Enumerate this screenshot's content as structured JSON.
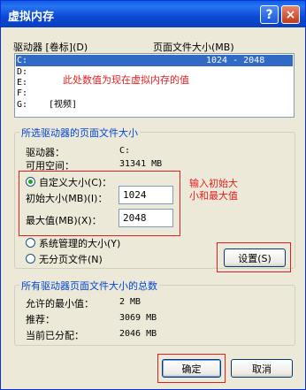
{
  "window": {
    "title": "虚拟内存",
    "help_label": "?",
    "close_label": "×"
  },
  "drives": {
    "header_drive": "驱动器 [卷标](D)",
    "header_size": "页面文件大小(MB)",
    "items": [
      {
        "drive": "C:",
        "size": "1024 - 2048",
        "selected": true
      },
      {
        "drive": "D:",
        "size": ""
      },
      {
        "drive": "E:",
        "size": ""
      },
      {
        "drive": "F:",
        "size": ""
      },
      {
        "drive": "G:",
        "label": "[视频]",
        "size": ""
      }
    ]
  },
  "selected_drive": {
    "group_title": "所选驱动器的页面文件大小",
    "drive_label": "驱动器：",
    "drive_value": "C:",
    "space_label": "可用空间：",
    "space_value": "31341 MB",
    "custom_size_label": "自定义大小(C)：",
    "initial_label": "初始大小(MB)(I)：",
    "initial_value": "1024",
    "max_label": "最大值(MB)(X)：",
    "max_value": "2048",
    "system_managed_label": "系统管理的大小(Y)",
    "no_paging_label": "无分页文件(N)",
    "set_button": "设置(S)"
  },
  "totals": {
    "group_title": "所有驱动器页面文件大小的总数",
    "min_label": "允许的最小值：",
    "min_value": "2 MB",
    "recommended_label": "推荐：",
    "recommended_value": "3069 MB",
    "allocated_label": "当前已分配：",
    "allocated_value": "2046 MB"
  },
  "buttons": {
    "ok": "确定",
    "cancel": "取消"
  },
  "annotations": {
    "list_note": "此处数值为现在虚拟内存的值",
    "input_note_line1": "输入初始大",
    "input_note_line2": "小和最大值"
  },
  "colors": {
    "annotation": "#e02020",
    "selection": "#316ac5",
    "titlebar": "#0a49d4"
  }
}
